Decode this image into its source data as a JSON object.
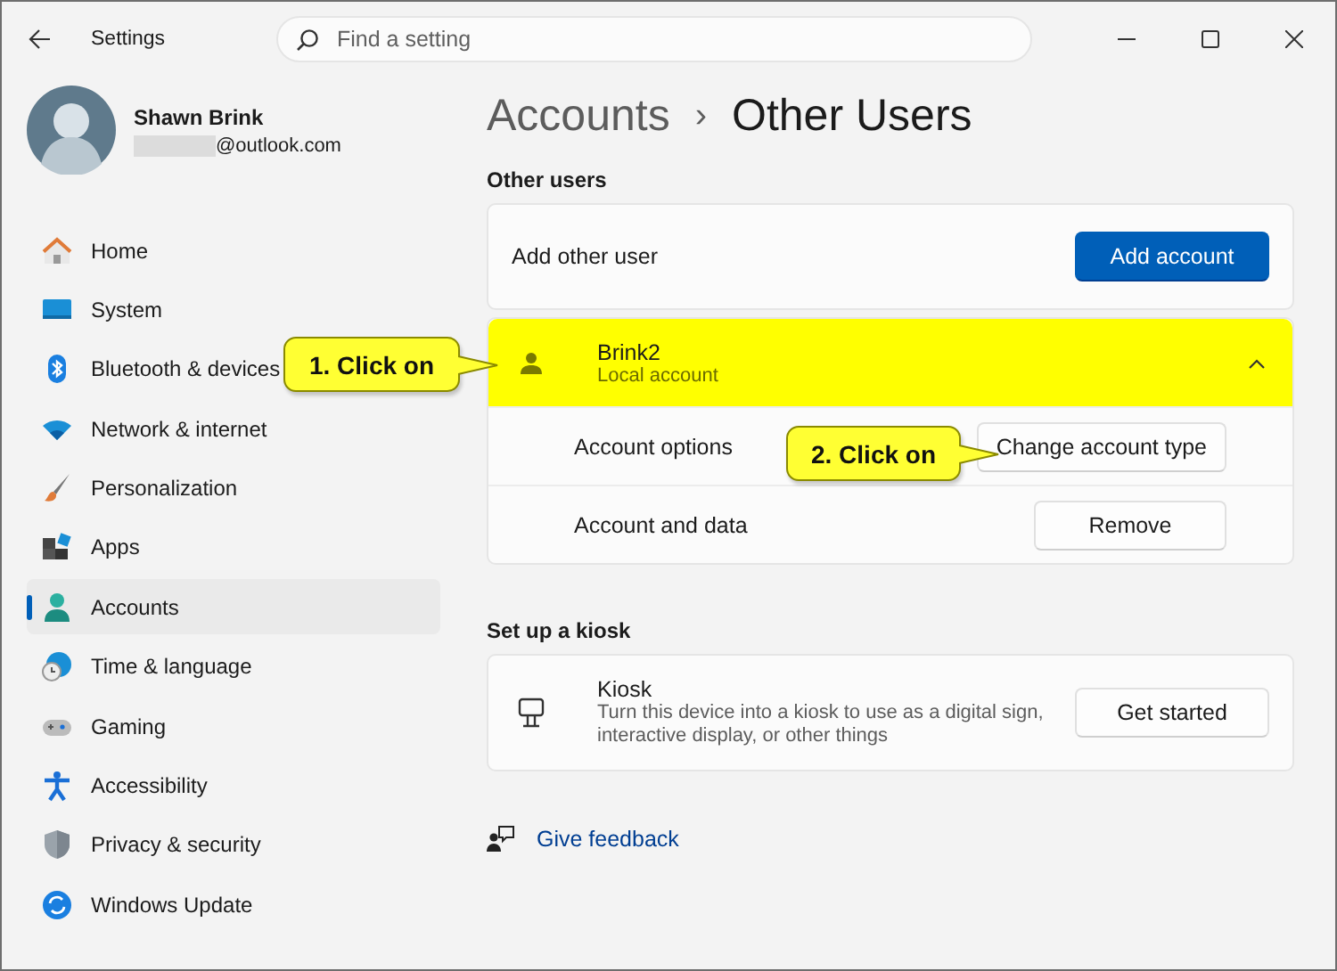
{
  "window": {
    "title": "Settings"
  },
  "search": {
    "placeholder": "Find a setting"
  },
  "profile": {
    "name": "Shawn Brink",
    "email": "@outlook.com"
  },
  "sidebar": {
    "items": [
      {
        "label": "Home",
        "selected": false
      },
      {
        "label": "System",
        "selected": false
      },
      {
        "label": "Bluetooth & devices",
        "selected": false
      },
      {
        "label": "Network & internet",
        "selected": false
      },
      {
        "label": "Personalization",
        "selected": false
      },
      {
        "label": "Apps",
        "selected": false
      },
      {
        "label": "Accounts",
        "selected": true
      },
      {
        "label": "Time & language",
        "selected": false
      },
      {
        "label": "Gaming",
        "selected": false
      },
      {
        "label": "Accessibility",
        "selected": false
      },
      {
        "label": "Privacy & security",
        "selected": false
      },
      {
        "label": "Windows Update",
        "selected": false
      }
    ]
  },
  "breadcrumb": {
    "parent": "Accounts",
    "separator": "›",
    "current": "Other Users"
  },
  "other_users": {
    "heading": "Other users",
    "add_label": "Add other user",
    "add_button": "Add account",
    "users": [
      {
        "name": "Brink2",
        "subtitle": "Local account",
        "expanded": true,
        "highlighted": true,
        "options": [
          {
            "label": "Account options",
            "button": "Change account type"
          },
          {
            "label": "Account and data",
            "button": "Remove"
          }
        ]
      }
    ]
  },
  "kiosk": {
    "heading": "Set up a kiosk",
    "title": "Kiosk",
    "description": "Turn this device into a kiosk to use as a digital sign, interactive display, or other things",
    "button": "Get started"
  },
  "feedback": "Give feedback",
  "callouts": [
    {
      "text": "1. Click on"
    },
    {
      "text": "2. Click on"
    }
  ]
}
